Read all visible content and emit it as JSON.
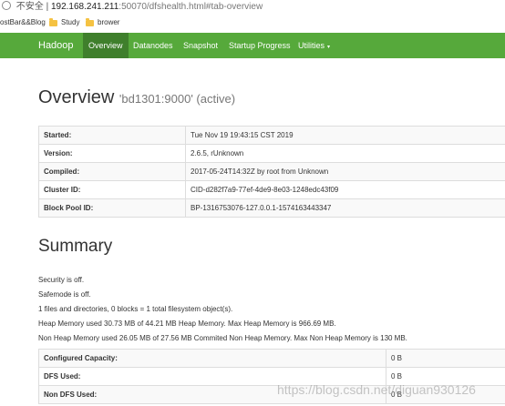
{
  "address_bar": {
    "security_label": "不安全",
    "host": "192.168.241.211",
    "path": ":50070/dfshealth.html#tab-overview"
  },
  "bookmarks": [
    {
      "label": "ostBar&&Blog"
    },
    {
      "label": "Study"
    },
    {
      "label": "brower"
    }
  ],
  "navbar": {
    "brand": "Hadoop",
    "links": [
      "Overview",
      "Datanodes",
      "Snapshot",
      "Startup Progress",
      "Utilities"
    ]
  },
  "overview": {
    "title": "Overview",
    "subtitle": "'bd1301:9000' (active)",
    "rows": [
      {
        "key": "Started:",
        "value": "Tue Nov 19 19:43:15 CST 2019"
      },
      {
        "key": "Version:",
        "value": "2.6.5, rUnknown"
      },
      {
        "key": "Compiled:",
        "value": "2017-05-24T14:32Z by root from Unknown"
      },
      {
        "key": "Cluster ID:",
        "value": "CID-d282f7a9-77ef-4de9-8e03-1248edc43f09"
      },
      {
        "key": "Block Pool ID:",
        "value": "BP-1316753076-127.0.0.1-1574163443347"
      }
    ]
  },
  "summary": {
    "title": "Summary",
    "lines": [
      "Security is off.",
      "Safemode is off.",
      "1 files and directories, 0 blocks = 1 total filesystem object(s).",
      "Heap Memory used 30.73 MB of 44.21 MB Heap Memory. Max Heap Memory is 966.69 MB.",
      "Non Heap Memory used 26.05 MB of 27.56 MB Commited Non Heap Memory. Max Non Heap Memory is 130 MB."
    ],
    "rows": [
      {
        "key": "Configured Capacity:",
        "value": "0 B"
      },
      {
        "key": "DFS Used:",
        "value": "0 B"
      },
      {
        "key": "Non DFS Used:",
        "value": "0 B"
      }
    ]
  },
  "watermark": "https://blog.csdn.net/diguan930126"
}
